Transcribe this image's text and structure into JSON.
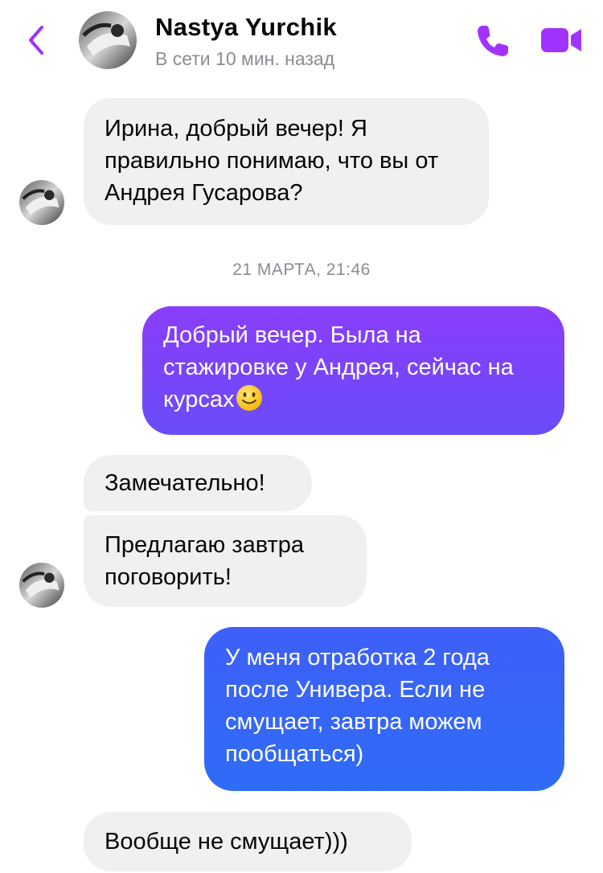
{
  "header": {
    "contact_name": "Nastya  Yurchik",
    "status": "В сети 10 мин. назад",
    "icons": {
      "back": "chevron-left-icon",
      "call": "phone-icon",
      "video": "video-camera-icon"
    },
    "accent_color": "#a033ff"
  },
  "conversation": {
    "msg1": "Ирина, добрый вечер! Я правильно понимаю, что вы от Андрея Гусарова?",
    "timestamp": "21 МАРТА, 21:46",
    "msg2": "Добрый вечер. Была на стажировке у Андрея, сейчас на курсах",
    "msg2_emoji": "slightly-smiling-face",
    "msg3": "Замечательно!",
    "msg4": "Предлагаю завтра поговорить!",
    "msg5": "У меня отработка 2 года после Универа. Если не смущает, завтра можем пообщаться)",
    "msg6": "Вообще не смущает)))"
  },
  "colors": {
    "incoming_bubble": "#f0f0f1",
    "outgoing_gradient_top": "#8a3dfb",
    "outgoing_gradient_mid": "#6a4cf9",
    "outgoing_gradient_bottom": "#2f6cf6"
  }
}
